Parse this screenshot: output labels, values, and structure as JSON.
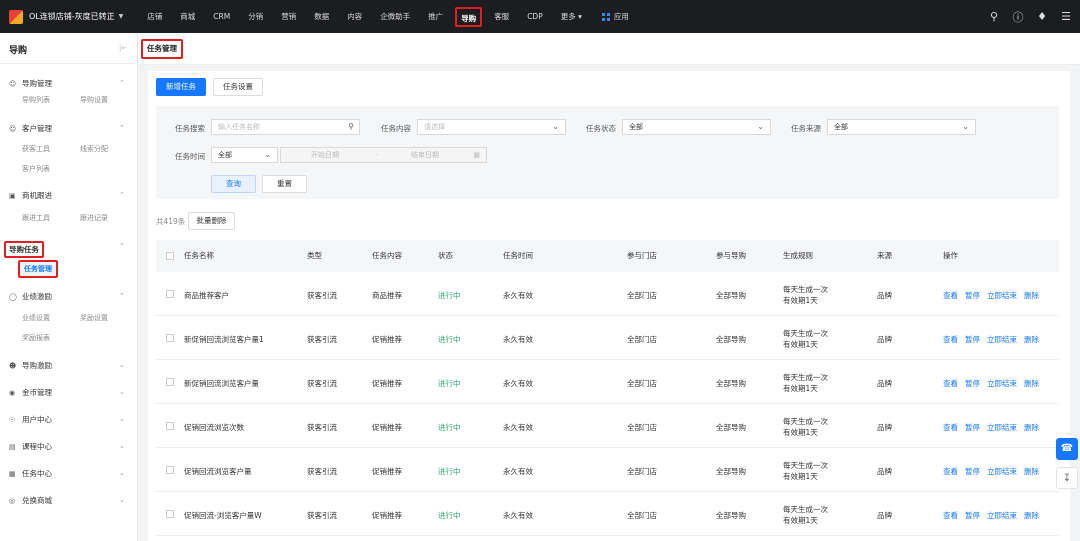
{
  "header": {
    "store_name": "OL连锁店铺-灰度已转正",
    "nav": [
      "店铺",
      "商城",
      "CRM",
      "分销",
      "营销",
      "数据",
      "内容",
      "企微助手",
      "推广",
      "导购",
      "客服",
      "CDP",
      "更多 ▾"
    ],
    "active_nav_index": 9,
    "apps_label": "应用"
  },
  "sidebar": {
    "title": "导购",
    "groups": [
      {
        "label": "导购管理",
        "icon": "person-icon",
        "subs": [
          "导购列表",
          "导购设置"
        ]
      },
      {
        "label": "客户管理",
        "icon": "person-icon",
        "subs": [
          "获客工具",
          "线索分配",
          "客户列表"
        ]
      },
      {
        "label": "商机跟进",
        "icon": "briefcase-icon",
        "subs": [
          "跟进工具",
          "跟进记录"
        ]
      },
      {
        "label": "导购任务",
        "icon": "",
        "subs": [
          "任务管理"
        ]
      },
      {
        "label": "业绩激励",
        "icon": "shield-icon",
        "subs": [
          "业绩设置",
          "奖励设置",
          "奖励报表"
        ]
      },
      {
        "label": "导购激励",
        "icon": "people-icon",
        "subs": []
      },
      {
        "label": "金币管理",
        "icon": "coin-icon",
        "subs": []
      },
      {
        "label": "用户中心",
        "icon": "user-circle-icon",
        "subs": []
      },
      {
        "label": "课程中心",
        "icon": "book-icon",
        "subs": []
      },
      {
        "label": "任务中心",
        "icon": "task-icon",
        "subs": []
      },
      {
        "label": "兑换商城",
        "icon": "exchange-icon",
        "subs": []
      }
    ]
  },
  "page": {
    "tab_title": "任务管理",
    "new_task": "新增任务",
    "task_settings": "任务设置"
  },
  "filters": {
    "search_label": "任务搜索",
    "search_placeholder": "输入任务名称",
    "content_label": "任务内容",
    "content_placeholder": "请选择",
    "status_label": "任务状态",
    "status_value": "全部",
    "source_label": "任务来源",
    "source_value": "全部",
    "time_label": "任务时间",
    "time_value": "全部",
    "start_date": "开始日期",
    "date_sep": "-",
    "end_date": "结束日期",
    "query": "查询",
    "reset": "重置"
  },
  "list": {
    "total": "共419条",
    "batch_delete": "批量删除",
    "columns": [
      "任务名称",
      "类型",
      "任务内容",
      "状态",
      "任务时间",
      "参与门店",
      "参与导购",
      "生成规则",
      "来源",
      "操作"
    ],
    "rows": [
      {
        "name": "商品推荐客户",
        "type": "获客引流",
        "content": "商品推荐",
        "status": "进行中",
        "time": "永久有效",
        "store": "全部门店",
        "guide": "全部导购",
        "rule1": "每天生成一次",
        "rule2": "有效期1天",
        "source": "品牌"
      },
      {
        "name": "新促销回流浏览客户量1",
        "type": "获客引流",
        "content": "促销推荐",
        "status": "进行中",
        "time": "永久有效",
        "store": "全部门店",
        "guide": "全部导购",
        "rule1": "每天生成一次",
        "rule2": "有效期1天",
        "source": "品牌"
      },
      {
        "name": "新促销回流浏览客户量",
        "type": "获客引流",
        "content": "促销推荐",
        "status": "进行中",
        "time": "永久有效",
        "store": "全部门店",
        "guide": "全部导购",
        "rule1": "每天生成一次",
        "rule2": "有效期1天",
        "source": "品牌"
      },
      {
        "name": "促销回流浏览次数",
        "type": "获客引流",
        "content": "促销推荐",
        "status": "进行中",
        "time": "永久有效",
        "store": "全部门店",
        "guide": "全部导购",
        "rule1": "每天生成一次",
        "rule2": "有效期1天",
        "source": "品牌"
      },
      {
        "name": "促销回流浏览客户量",
        "type": "获客引流",
        "content": "促销推荐",
        "status": "进行中",
        "time": "永久有效",
        "store": "全部门店",
        "guide": "全部导购",
        "rule1": "每天生成一次",
        "rule2": "有效期1天",
        "source": "品牌"
      },
      {
        "name": "促销回流-浏览客户量W",
        "type": "获客引流",
        "content": "促销推荐",
        "status": "进行中",
        "time": "永久有效",
        "store": "全部门店",
        "guide": "全部导购",
        "rule1": "每天生成一次",
        "rule2": "有效期1天",
        "source": "品牌"
      }
    ],
    "ops": [
      "查看",
      "暂停",
      "立即结束",
      "删除"
    ]
  }
}
